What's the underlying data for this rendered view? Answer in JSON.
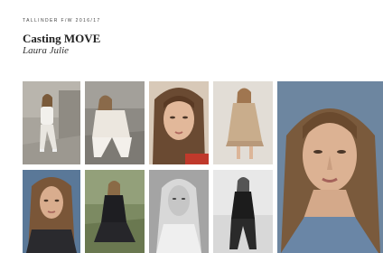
{
  "header": {
    "small_label": "TALLINDER F/W 2016/17",
    "title": "Casting MOVE",
    "subtitle": "Laura Julie"
  },
  "photos": [
    {
      "name": "photo-seated-white-outfit",
      "bg": "#a8a49c"
    },
    {
      "name": "photo-seated-knit-sweater",
      "bg": "#8d8a84"
    },
    {
      "name": "photo-portrait-closeup",
      "bg": "#5a4030"
    },
    {
      "name": "photo-beige-dress",
      "bg": "#e2ddd6"
    },
    {
      "name": "photo-large-portrait",
      "bg": "#6d86a0"
    },
    {
      "name": "photo-portrait-dark-top",
      "bg": "#5a7898"
    },
    {
      "name": "photo-garden-black-outfit",
      "bg": "#7c8a62"
    },
    {
      "name": "photo-bw-portrait",
      "bg": "#9a9a9a"
    },
    {
      "name": "photo-bw-standing",
      "bg": "#d8d8d8"
    }
  ]
}
